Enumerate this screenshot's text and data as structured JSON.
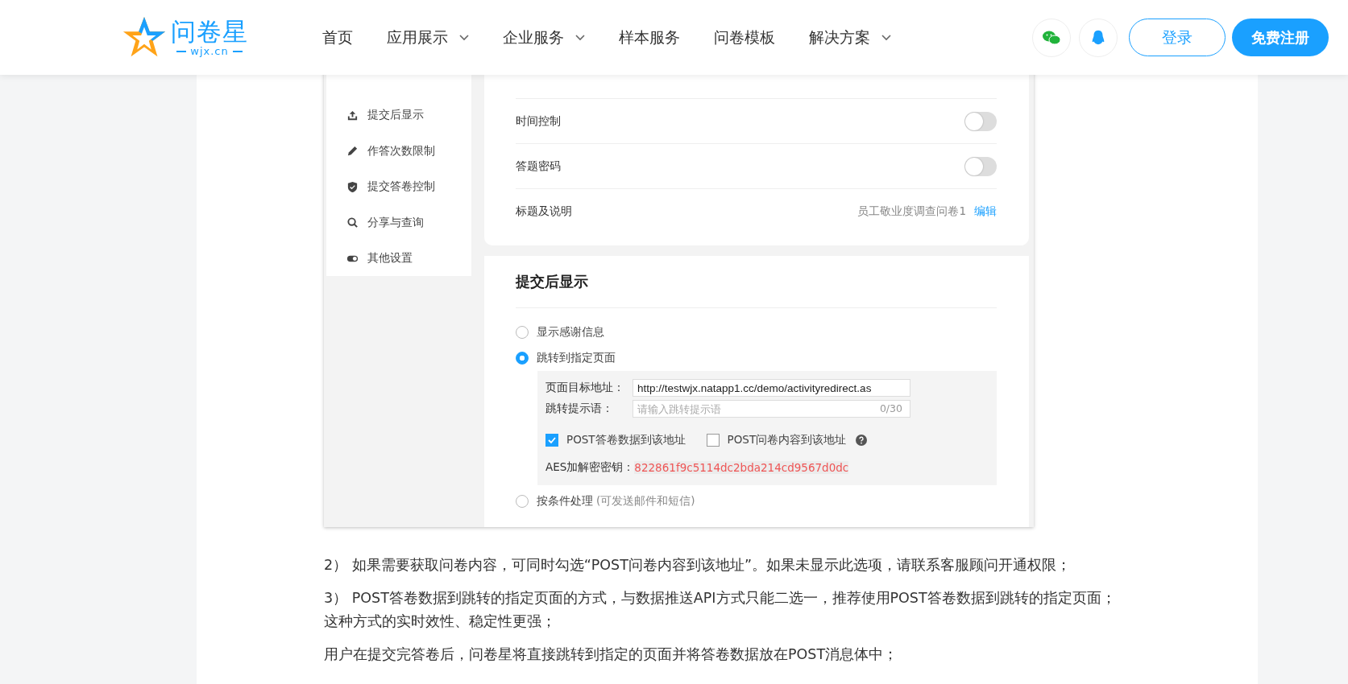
{
  "header": {
    "logo": {
      "name": "问卷星",
      "domain": "wjx.cn"
    },
    "nav": [
      {
        "label": "首页",
        "dropdown": false
      },
      {
        "label": "应用展示",
        "dropdown": true
      },
      {
        "label": "企业服务",
        "dropdown": true
      },
      {
        "label": "样本服务",
        "dropdown": false
      },
      {
        "label": "问卷模板",
        "dropdown": false
      },
      {
        "label": "解决方案",
        "dropdown": true
      }
    ],
    "login": "登录",
    "register": "免费注册"
  },
  "screenshot": {
    "sidebar": [
      {
        "label": "提交后显示",
        "kind": "upload"
      },
      {
        "label": "作答次数限制",
        "kind": "pencil"
      },
      {
        "label": "提交答卷控制",
        "kind": "shield"
      },
      {
        "label": "分享与查询",
        "kind": "search"
      },
      {
        "label": "其他设置",
        "kind": "toggle"
      }
    ],
    "basic": {
      "rows": [
        {
          "kind": "toggle",
          "label": "时间控制",
          "on": false
        },
        {
          "kind": "toggle",
          "label": "答题密码",
          "on": false
        },
        {
          "kind": "value",
          "label": "标题及说明",
          "value": "员工敬业度调查问卷1",
          "link": "编辑"
        }
      ]
    },
    "after_submit": {
      "heading": "提交后显示",
      "options": [
        {
          "label": "显示感谢信息",
          "selected": false
        },
        {
          "label": "跳转到指定页面",
          "selected": true,
          "details": true
        },
        {
          "label": "按条件处理",
          "note": "(可发送邮件和短信)",
          "selected": false
        }
      ],
      "redirect": {
        "url_label": "页面目标地址：",
        "url_value": "http://testwjx.natapp1.cc/demo/activityredirect.as",
        "tip_label": "跳转提示语：",
        "tip_placeholder": "请输入跳转提示语",
        "tip_count": "0/30",
        "checkboxes": [
          {
            "label": "POST答卷数据到该地址",
            "checked": true
          },
          {
            "label": "POST问卷内容到该地址",
            "checked": false,
            "help": true
          }
        ],
        "aes_label": "AES加解密密钥：",
        "aes_value": "822861f9c5114dc2bda214cd9567d0dc"
      }
    }
  },
  "article": [
    "2） 如果需要获取问卷内容，可同时勾选“POST问卷内容到该地址”。如果未显示此选项，请联系客服顾问开通权限；",
    "3） POST答卷数据到跳转的指定页面的方式，与数据推送API方式只能二选一，推荐使用POST答卷数据到跳转的指定页面；这种方式的实时效性、稳定性更强；",
    "用户在提交完答卷后，问卷星将直接跳转到指定的页面并将答卷数据放在POST消息体中；"
  ]
}
